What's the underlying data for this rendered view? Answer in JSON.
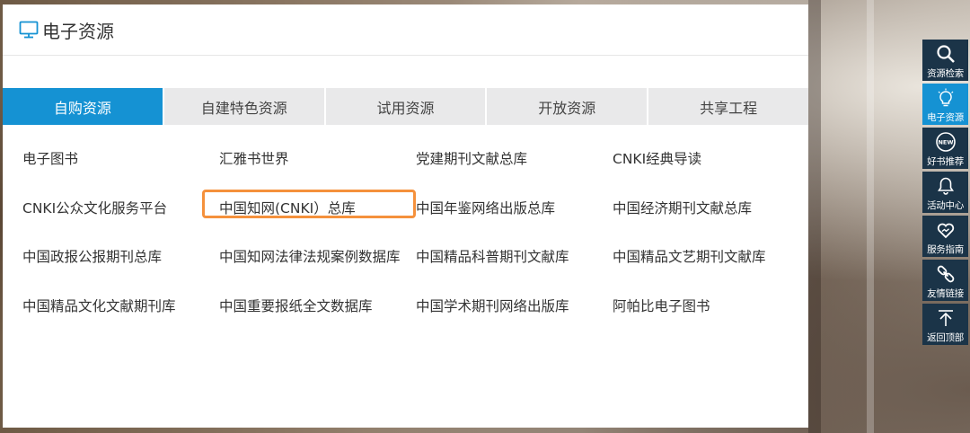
{
  "panel": {
    "title": "电子资源",
    "icon": "monitor-icon"
  },
  "tabs": [
    {
      "label": "自购资源",
      "active": true
    },
    {
      "label": "自建特色资源",
      "active": false
    },
    {
      "label": "试用资源",
      "active": false
    },
    {
      "label": "开放资源",
      "active": false
    },
    {
      "label": "共享工程",
      "active": false
    }
  ],
  "resources": [
    "电子图书",
    "汇雅书世界",
    "党建期刊文献总库",
    "CNKI经典导读",
    "CNKI公众文化服务平台",
    "中国知网(CNKI）总库",
    "中国年鉴网络出版总库",
    "中国经济期刊文献总库",
    "中国政报公报期刊总库",
    "中国知网法律法规案例数据库",
    "中国精品科普期刊文献库",
    "中国精品文艺期刊文献库",
    "中国精品文化文献期刊库",
    "中国重要报纸全文数据库",
    "中国学术期刊网络出版库",
    "阿帕比电子图书"
  ],
  "highlighted_resource": "中国知网(CNKI）总库",
  "sidebar": [
    {
      "label": "资源检索",
      "icon": "search-icon",
      "active": false
    },
    {
      "label": "电子资源",
      "icon": "lightbulb-icon",
      "active": true
    },
    {
      "label": "好书推荐",
      "icon": "new-badge-icon",
      "active": false
    },
    {
      "label": "活动中心",
      "icon": "bell-icon",
      "active": false
    },
    {
      "label": "服务指南",
      "icon": "heart-icon",
      "active": false
    },
    {
      "label": "友情链接",
      "icon": "link-icon",
      "active": false
    },
    {
      "label": "返回顶部",
      "icon": "arrow-up-icon",
      "active": false
    }
  ],
  "colors": {
    "accent": "#1592d3",
    "sidebar_bg": "#1b3448",
    "highlight_border": "#f5913c"
  }
}
